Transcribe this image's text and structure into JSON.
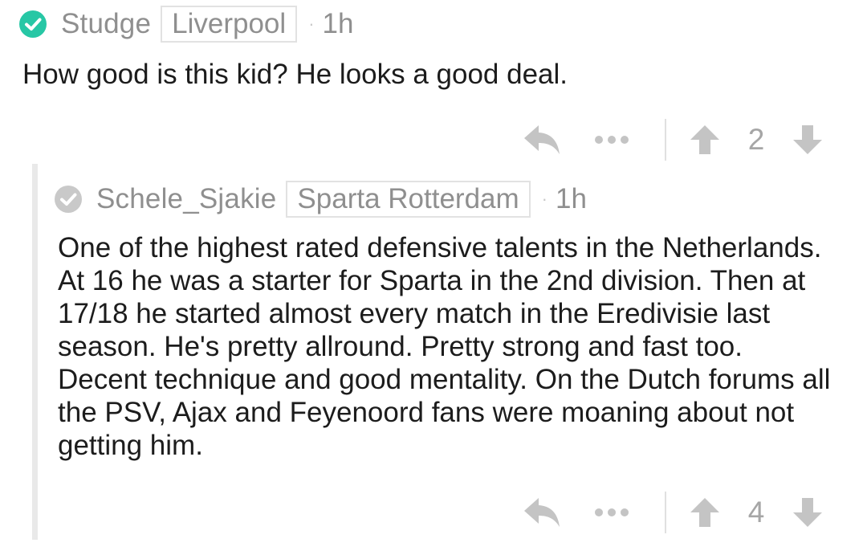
{
  "colors": {
    "status_active": "#27c7a5",
    "status_inactive": "#c9c9c9",
    "meta_text": "#8f8f8f",
    "icon_gray": "#c4c4c4",
    "body_text": "#1c1c1c"
  },
  "top_comment": {
    "username": "Studge",
    "flair": "Liverpool",
    "dot": "·",
    "age": "1h",
    "body": "How good is this kid? He looks a good deal.",
    "status_icon": "check-circle-icon",
    "score": "2"
  },
  "reply_comment": {
    "username": "Schele_Sjakie",
    "flair": "Sparta Rotterdam",
    "dot": "·",
    "age": "1h",
    "status_icon": "check-circle-icon",
    "body_lines": [
      "One of the highest rated defensive talents in the Netherlands.",
      "At 16 he was a starter for Sparta in the 2nd division. Then at",
      "17/18 he started almost every match in the Eredivisie last",
      "season. He's pretty allround. Pretty strong and fast too.",
      "Decent technique and good mentality. On the Dutch forums all",
      "the PSV, Ajax and Feyenoord fans were moaning about not",
      "getting him."
    ],
    "score": "4"
  },
  "actions": {
    "reply_icon": "reply-arrow-icon",
    "more_icon": "more-dots-icon",
    "upvote_icon": "upvote-arrow-icon",
    "downvote_icon": "downvote-arrow-icon"
  }
}
